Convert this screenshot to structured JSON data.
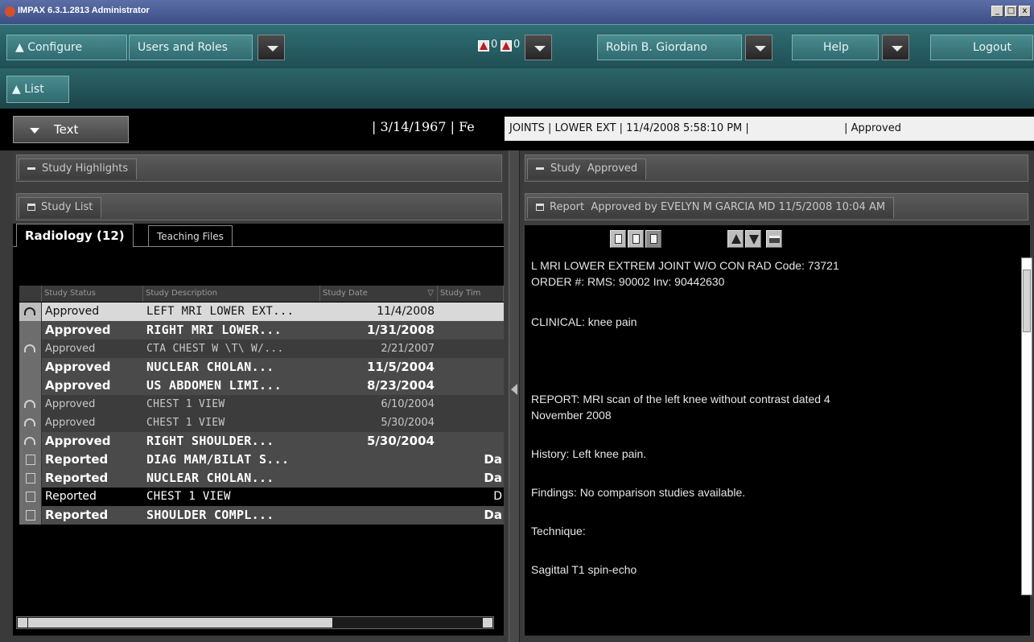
{
  "window": {
    "title": "IMPAX 6.3.1.2813 Administrator",
    "controls": [
      "_",
      "□",
      "x"
    ]
  },
  "toolbar": {
    "configure_label": "Configure",
    "users_roles_label": "Users and Roles",
    "alert1_count": "0",
    "alert2_count": "0",
    "user_name": "Robin B. Giordano",
    "help_label": "Help",
    "logout_label": "Logout"
  },
  "listbar": {
    "list_label": "List"
  },
  "banner": {
    "text_button": "Text",
    "dob_sex": "| 3/14/1967  | Fe",
    "study_info_a": "JOINTS | LOWER EXT | 11/4/2008 5:58:10 PM |",
    "study_info_b": "| Approved"
  },
  "left": {
    "highlights_label": "Study Highlights",
    "study_list_label": "Study List",
    "tabs": [
      "Radiology (12)",
      "Teaching Files"
    ],
    "columns": [
      "Study Status",
      "Study Description",
      "Study Date",
      "Study Tim"
    ],
    "rows": [
      {
        "status": "Approved",
        "desc": "LEFT MRI LOWER EXT...",
        "date": "11/4/2008",
        "time": ""
      },
      {
        "status": "Approved",
        "desc": "RIGHT MRI LOWER...",
        "date": "1/31/2008",
        "time": ""
      },
      {
        "status": "Approved",
        "desc": "CTA CHEST W \\T\\ W/...",
        "date": "2/21/2007",
        "time": ""
      },
      {
        "status": "Approved",
        "desc": "NUCLEAR CHOLAN...",
        "date": "11/5/2004",
        "time": ""
      },
      {
        "status": "Approved",
        "desc": "US ABDOMEN LIMI...",
        "date": "8/23/2004",
        "time": ""
      },
      {
        "status": "Approved",
        "desc": "CHEST 1 VIEW",
        "date": "6/10/2004",
        "time": ""
      },
      {
        "status": "Approved",
        "desc": "CHEST 1 VIEW",
        "date": "5/30/2004",
        "time": ""
      },
      {
        "status": "Approved",
        "desc": "RIGHT SHOULDER...",
        "date": "5/30/2004",
        "time": ""
      },
      {
        "status": "Reported",
        "desc": "DIAG MAM/BILAT S...",
        "date": "",
        "time": "Da"
      },
      {
        "status": "Reported",
        "desc": "NUCLEAR CHOLAN...",
        "date": "",
        "time": "Da"
      },
      {
        "status": "Reported",
        "desc": "CHEST 1 VIEW",
        "date": "",
        "time": "D"
      },
      {
        "status": "Reported",
        "desc": "SHOULDER COMPL...",
        "date": "",
        "time": "Da"
      }
    ]
  },
  "right": {
    "study_label": "Study",
    "study_status": "Approved",
    "report_label": "Report",
    "report_status": "Approved by EVELYN M GARCIA MD  11/5/2008 10:04 AM",
    "report_lines": [
      "L MRI LOWER EXTREM JOINT W/O CON     RAD Code: 73721",
      "ORDER #: RMS: 90002  Inv: 90442630",
      "CLINICAL: knee pain",
      "REPORT:  MRI scan of the left knee without contrast dated 4",
      "November 2008",
      "History: Left knee pain.",
      "Findings: No comparison studies available.",
      "Technique:",
      "Sagittal T1 spin-echo"
    ]
  },
  "colors": {
    "toolbar": "#2f6f74",
    "accent_alert": "#c21a1a",
    "selected_row": "#d9d9d9"
  }
}
